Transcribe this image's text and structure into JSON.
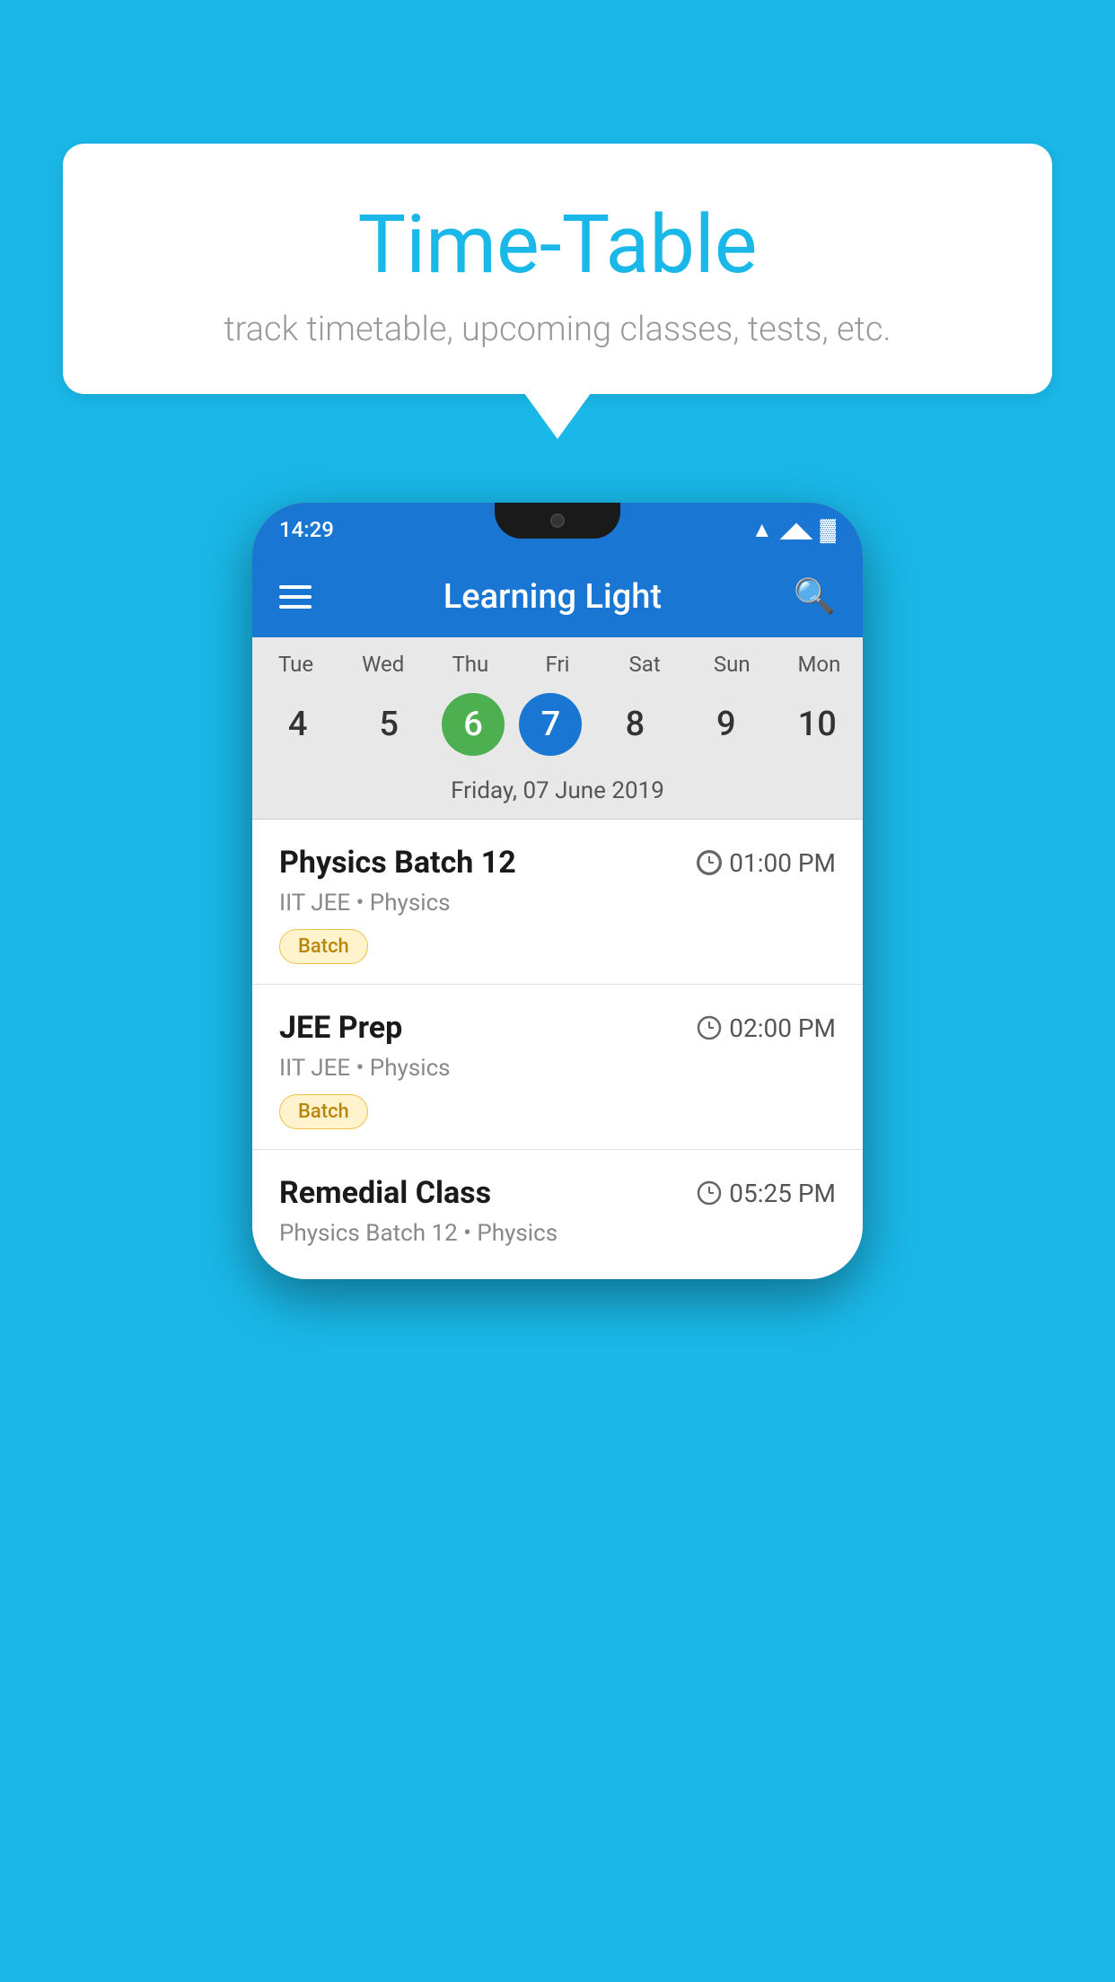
{
  "background_color": "#1ab8e8",
  "speech_bubble": {
    "title": "Time-Table",
    "subtitle": "track timetable, upcoming classes, tests, etc."
  },
  "phone": {
    "status_bar": {
      "time": "14:29",
      "icons": [
        "wifi",
        "signal",
        "battery"
      ]
    },
    "app_bar": {
      "title": "Learning Light",
      "menu_icon": "hamburger",
      "search_icon": "search"
    },
    "calendar": {
      "days": [
        "Tue",
        "Wed",
        "Thu",
        "Fri",
        "Sat",
        "Sun",
        "Mon"
      ],
      "dates": [
        "4",
        "5",
        "6",
        "7",
        "8",
        "9",
        "10"
      ],
      "today_index": 2,
      "selected_index": 3,
      "selected_label": "Friday, 07 June 2019"
    },
    "schedule_items": [
      {
        "title": "Physics Batch 12",
        "time": "01:00 PM",
        "subtitle": "IIT JEE • Physics",
        "badge": "Batch"
      },
      {
        "title": "JEE Prep",
        "time": "02:00 PM",
        "subtitle": "IIT JEE • Physics",
        "badge": "Batch"
      },
      {
        "title": "Remedial Class",
        "time": "05:25 PM",
        "subtitle": "Physics Batch 12 • Physics",
        "badge": null
      }
    ]
  }
}
